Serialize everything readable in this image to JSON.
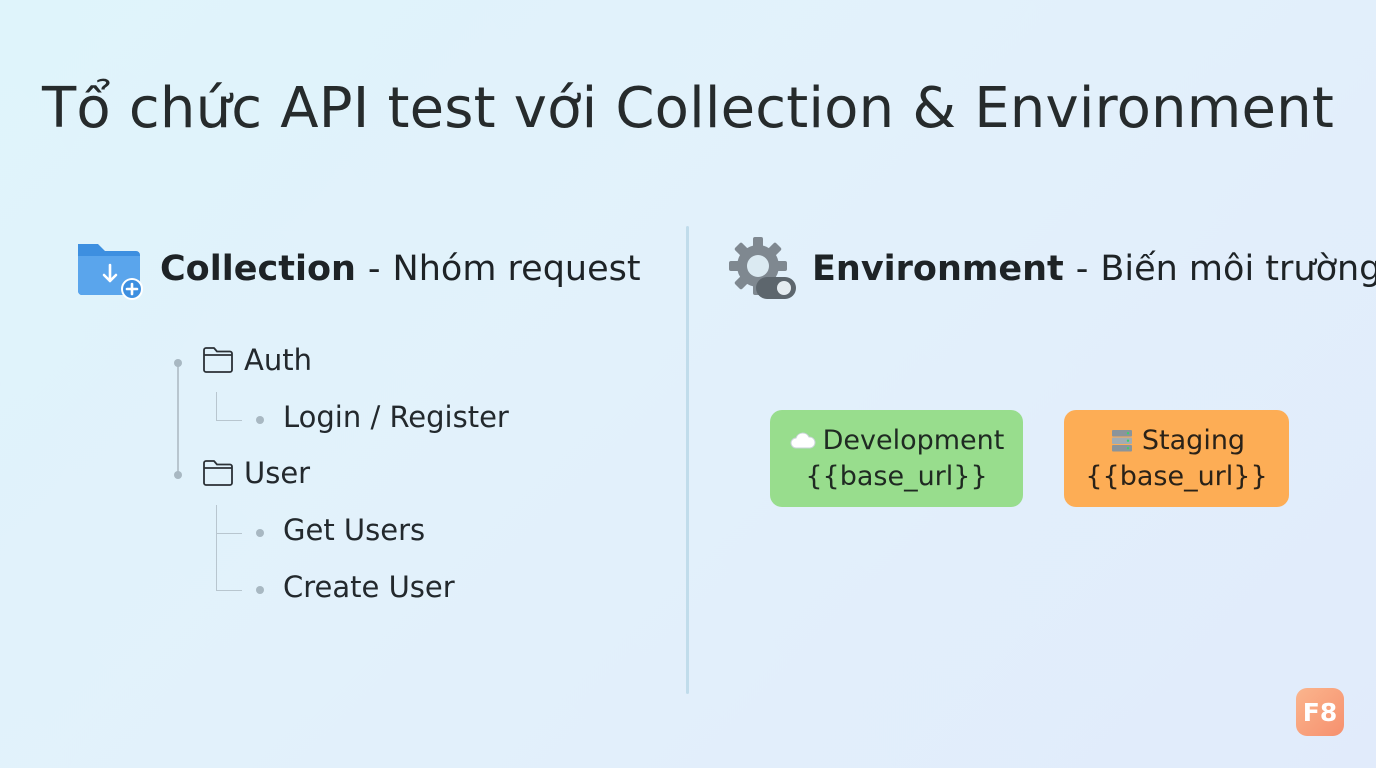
{
  "title": "Tổ chức API test với Collection & Environment",
  "collection": {
    "heading": "Collection",
    "separator": "-",
    "subheading": "Nhóm request",
    "icon": "folder-download-add-icon",
    "tree": [
      {
        "label": "Auth",
        "icon": "folder-icon",
        "children": [
          "Login / Register"
        ]
      },
      {
        "label": "User",
        "icon": "folder-icon",
        "children": [
          "Get Users",
          "Create User"
        ]
      }
    ]
  },
  "environment": {
    "heading": "Environment",
    "separator": "-",
    "subheading": "Biến môi trường",
    "icon": "gear-toggle-icon",
    "cards": [
      {
        "name": "Development",
        "variable": "{{base_url}}",
        "icon": "cloud-icon",
        "color": "#98dd8d"
      },
      {
        "name": "Staging",
        "variable": "{{base_url}}",
        "icon": "server-icon",
        "color": "#fdad55"
      }
    ]
  },
  "logo": "F8",
  "colors": {
    "accent_blue": "#3d8fe0",
    "divider": "#c0dceb",
    "logo": "#f6906e"
  }
}
